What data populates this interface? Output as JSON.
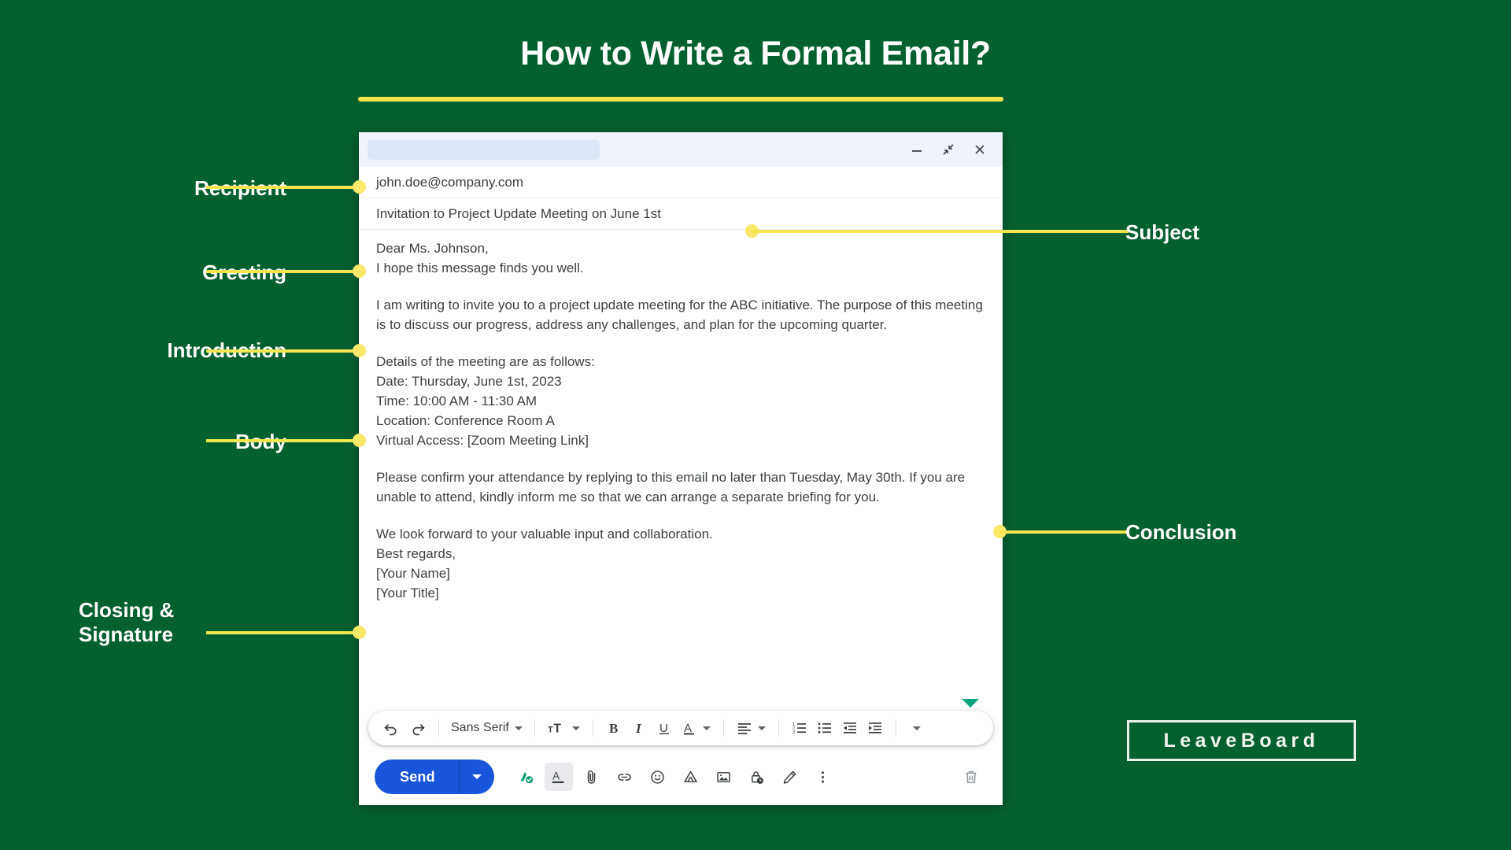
{
  "slide": {
    "title": "How to Write a Formal Email?",
    "background_color": "#056030",
    "accent_color": "#f5e64f",
    "logo": "LeaveBoard"
  },
  "compose_window": {
    "title_placeholder": "",
    "window_controls": [
      {
        "name": "minimize",
        "glyph": "minimize-icon"
      },
      {
        "name": "exit-full-screen",
        "glyph": "exit-fullscreen-icon"
      },
      {
        "name": "close",
        "glyph": "close-icon"
      }
    ],
    "recipient": "john.doe@company.com",
    "subject": "Invitation to Project Update Meeting on June 1st",
    "body": {
      "greeting_line_1": "Dear Ms. Johnson,",
      "greeting_line_2": "I hope this message finds you well.",
      "introduction": "I am writing to invite you to a project update meeting for the ABC initiative. The purpose of this meeting is to discuss our progress, address any challenges, and plan for the upcoming quarter.",
      "details_intro": "Details of the meeting are as follows:",
      "details": [
        "Date: Thursday, June 1st, 2023",
        "Time: 10:00 AM - 11:30 AM",
        "Location: Conference Room A",
        "Virtual Access: [Zoom Meeting Link]"
      ],
      "conclusion": "Please confirm your attendance by replying to this email no later than Tuesday, May 30th. If you are unable to attend, kindly inform me so that we can arrange a separate briefing for you.",
      "closing_line": "We look forward to your valuable input and collaboration.",
      "sign_off": "Best regards,",
      "signature_name": "[Your Name]",
      "signature_title": "[Your Title]"
    },
    "format_toolbar": {
      "undo": "undo-icon",
      "redo": "redo-icon",
      "font_family": "Sans Serif",
      "font_size": "font-size-icon",
      "bold": "B",
      "italic": "I",
      "underline": "U",
      "text_color": "A",
      "align": "align-left-icon",
      "numbered_list": "numbered-list-icon",
      "bullet_list": "bullet-list-icon",
      "indent_less": "indent-decrease-icon",
      "indent_more": "indent-increase-icon",
      "more": "more-formatting-icon"
    },
    "action_bar": {
      "send_label": "Send",
      "send_color": "#1a56db",
      "icons": [
        "grammar-check-icon",
        "formatting-options-icon",
        "attach-file-icon",
        "insert-link-icon",
        "insert-emoji-icon",
        "insert-drive-icon",
        "insert-photo-icon",
        "confidential-mode-icon",
        "insert-signature-icon",
        "more-options-icon"
      ],
      "discard": "delete-draft-icon"
    }
  },
  "annotations": [
    {
      "label": "Recipient",
      "side": "left"
    },
    {
      "label": "Greeting",
      "side": "left"
    },
    {
      "label": "Introduction",
      "side": "left"
    },
    {
      "label": "Body",
      "side": "left"
    },
    {
      "label": "Closing &\nSignature",
      "side": "left"
    },
    {
      "label": "Subject",
      "side": "right"
    },
    {
      "label": "Conclusion",
      "side": "right"
    }
  ]
}
